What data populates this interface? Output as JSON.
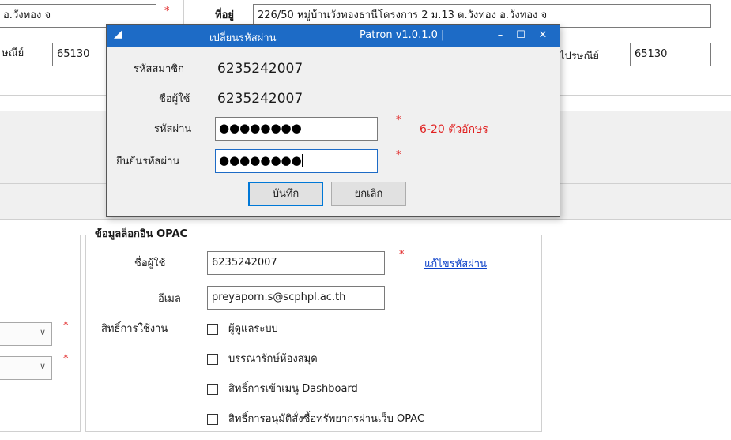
{
  "background": {
    "address_left_value": "อ.วังทอง จ",
    "address_label": "ที่อยู่",
    "address_value": "226/50 หมู่บ้านวังทองธานีโครงการ 2 ม.13 ต.วังทอง อ.วังทอง จ",
    "postal_left_label": "ษณีย์",
    "postal_left_value": "65130",
    "postal_right_label": "ไปรษณีย์",
    "postal_right_value": "65130",
    "opac_section": {
      "title": "ข้อมูลล็อกอิน OPAC",
      "username_label": "ชื่อผู้ใช้",
      "username_value": "6235242007",
      "change_password_link": "แก้ไขรหัสผ่าน",
      "email_label": "อีเมล",
      "email_value": "preyaporn.s@scphpl.ac.th",
      "rights_label": "สิทธิ์การใช้งาน",
      "permissions": [
        "ผู้ดูแลระบบ",
        "บรรณารักษ์ห้องสมุด",
        "สิทธิ์การเข้าเมนู Dashboard",
        "สิทธิ์การอนุมัติสั่งซื้อทรัพยากรผ่านเว็บ OPAC"
      ]
    },
    "required_mark": "*"
  },
  "dialog": {
    "title": "เปลี่ยนรหัสผ่าน",
    "version": "Patron v1.0.1.0 |",
    "minimize": "–",
    "maximize": "☐",
    "close": "✕",
    "member_id_label": "รหัสสมาชิก",
    "member_id_value": "6235242007",
    "username_label": "ชื่อผู้ใช้",
    "username_value": "6235242007",
    "password_label": "รหัสผ่าน",
    "password_value": "●●●●●●●●",
    "password_hint": "6-20 ตัวอักษร",
    "confirm_label": "ยืนยันรหัสผ่าน",
    "confirm_value": "●●●●●●●●",
    "save_label": "บันทึก",
    "cancel_label": "ยกเลิก",
    "required_mark": "*"
  },
  "colors": {
    "titlebar": "#1d6bc6",
    "required": "#e02020",
    "link": "#0a3fc8"
  }
}
